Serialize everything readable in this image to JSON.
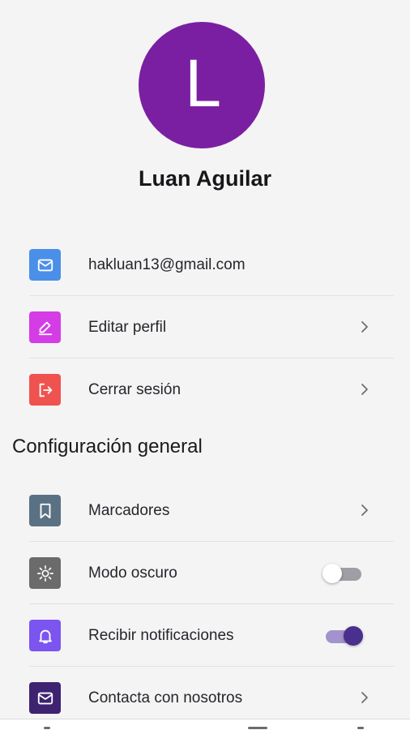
{
  "profile": {
    "avatar_initial": "L",
    "name": "Luan Aguilar",
    "avatar_color": "#7b1fa2"
  },
  "account": {
    "email": "hakluan13@gmail.com",
    "edit_profile": "Editar perfil",
    "logout": "Cerrar sesión"
  },
  "general_settings": {
    "title": "Configuración general",
    "bookmarks": "Marcadores",
    "dark_mode": "Modo oscuro",
    "dark_mode_enabled": false,
    "notifications": "Recibir notificaciones",
    "notifications_enabled": true,
    "contact": "Contacta con nosotros"
  },
  "icon_colors": {
    "email": "#4a8fe8",
    "edit": "#d43ce6",
    "logout": "#f0524f",
    "bookmarks": "#5a7184",
    "dark_mode": "#6b6b6b",
    "notifications": "#7c54f0",
    "contact": "#3d2370"
  },
  "icons": {
    "email": "mail-icon",
    "edit": "pencil-icon",
    "logout": "logout-icon",
    "bookmarks": "bookmark-icon",
    "dark_mode": "sun-icon",
    "notifications": "bell-icon",
    "contact": "mail-icon",
    "chevron": "chevron-right-icon"
  }
}
